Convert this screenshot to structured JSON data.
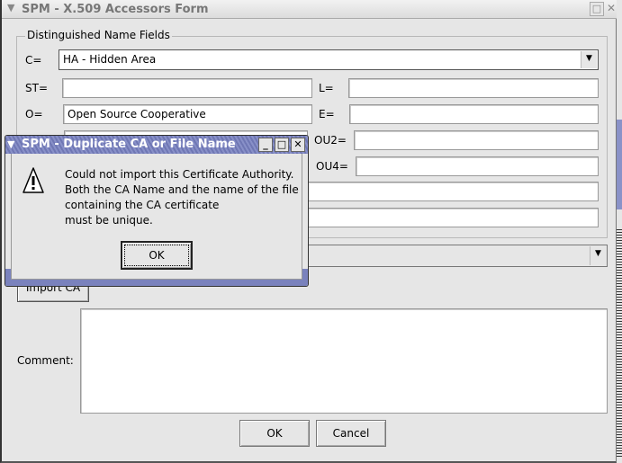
{
  "main_window": {
    "title": "SPM - X.509 Accessors Form",
    "group_label": "Distinguished Name Fields",
    "fields": {
      "c_label": "C=",
      "c_value": "HA - Hidden Area",
      "st_label": "ST=",
      "st_value": "",
      "l_label": "L=",
      "l_value": "",
      "o_label": "O=",
      "o_value": "Open Source Cooperative",
      "e_label": "E=",
      "e_value": "",
      "ou2_label": "OU2=",
      "ou2_value": "",
      "ou4_label": "OU4=",
      "ou4_value": ""
    },
    "import_ca_label": "Import CA",
    "comment_label": "Comment:",
    "comment_value": "",
    "ok_label": "OK",
    "cancel_label": "Cancel"
  },
  "dialog": {
    "title": "SPM - Duplicate CA or File Name",
    "icon": "warning-icon",
    "message_lines": [
      "Could not import this Certificate Authority.",
      "Both the CA Name and the name of the file",
      "containing the CA certificate",
      "must be unique."
    ],
    "ok_label": "OK"
  },
  "colors": {
    "dialog_title": "#7a82bd",
    "window_bg": "#e6e6e6"
  }
}
